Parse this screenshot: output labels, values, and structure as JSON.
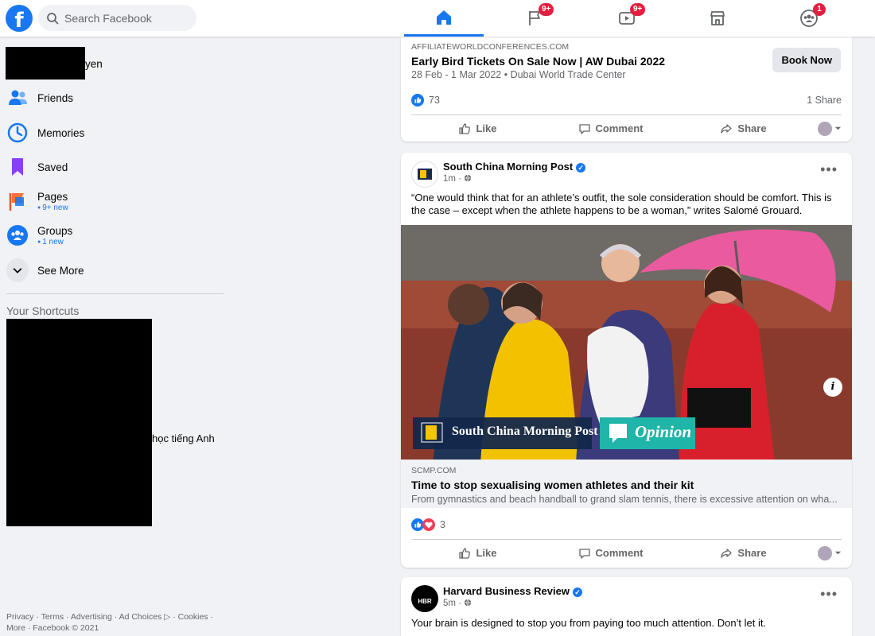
{
  "topbar": {
    "logo_letter": "f",
    "search_placeholder": "Search Facebook",
    "tabs": [
      {
        "name": "home",
        "badge": ""
      },
      {
        "name": "pages",
        "badge": "9+"
      },
      {
        "name": "watch",
        "badge": "9+"
      },
      {
        "name": "marketplace",
        "badge": ""
      },
      {
        "name": "groups",
        "badge": "1"
      }
    ]
  },
  "sidebar": {
    "profile_name_visible": "yen",
    "items": [
      {
        "label": "Friends",
        "sub": "",
        "icon": "friends-icon"
      },
      {
        "label": "Memories",
        "sub": "",
        "icon": "memories-icon"
      },
      {
        "label": "Saved",
        "sub": "",
        "icon": "saved-icon"
      },
      {
        "label": "Pages",
        "sub": "9+ new",
        "icon": "pages-icon"
      },
      {
        "label": "Groups",
        "sub": "1 new",
        "icon": "groups-icon"
      },
      {
        "label": "See More",
        "sub": "",
        "icon": "chevron-down-icon"
      }
    ],
    "shortcuts_title": "Your Shortcuts",
    "shortcut_visible_text": "học tiếng Anh",
    "footer": "Privacy · Terms · Advertising · Ad Choices ▷ · Cookies · More · Facebook © 2021"
  },
  "feed": {
    "ad_card": {
      "domain": "AFFILIATEWORLDCONFERENCES.COM",
      "title": "Early Bird Tickets On Sale Now | AW Dubai 2022",
      "subtitle": "28 Feb - 1 Mar 2022 • Dubai World Trade Center",
      "cta": "Book Now",
      "reaction_count": "73",
      "shares": "1 Share"
    },
    "actions": {
      "like": "Like",
      "comment": "Comment",
      "share": "Share"
    },
    "scmp_post": {
      "author": "South China Morning Post",
      "time": "1m ·",
      "text": "“One would think that for an athlete’s outfit, the sole consideration should be comfort. This is the case – except when the athlete happens to be a woman,” writes Salomé Grouard.",
      "image_brand": "South China Morning Post",
      "image_tag": "Opinion",
      "link_domain": "SCMP.COM",
      "link_title": "Time to stop sexualising women athletes and their kit",
      "link_desc": "From gymnastics and beach handball to grand slam tennis, there is excessive attention on wha...",
      "reaction_count": "3"
    },
    "hbr_post": {
      "author": "Harvard Business Review",
      "avatar_text": "HBR",
      "time": "5m ·",
      "text": "Your brain is designed to stop you from paying too much attention. Don’t let it."
    }
  },
  "colors": {
    "brand": "#1877f2",
    "badge": "#e41e3f",
    "background": "#f0f2f5"
  }
}
